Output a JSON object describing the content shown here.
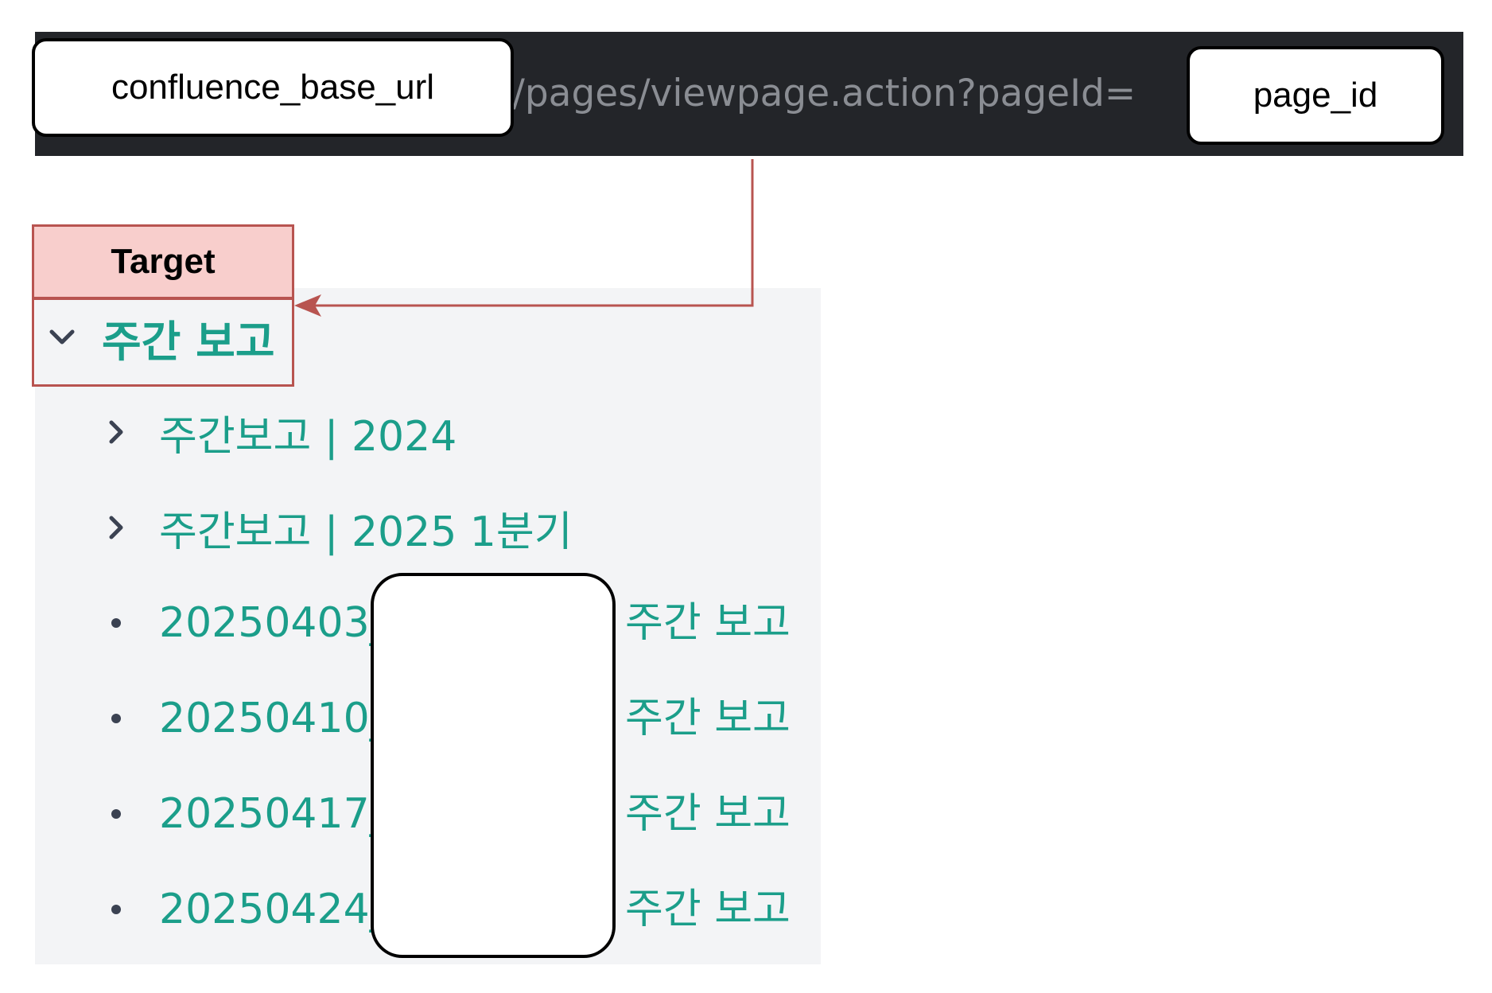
{
  "url_bar": {
    "base_url_placeholder": "confluence_base_url",
    "path": "/pages/viewpage.action?pageId=",
    "page_id_placeholder": "page_id"
  },
  "annotation": {
    "target_label": "Target",
    "color": "#b85450",
    "fill": "#f8cecc"
  },
  "tree": {
    "root": {
      "label": "주간 보고",
      "icon": "chevron-down-icon"
    },
    "children": [
      {
        "label": "주간보고 | 2024",
        "icon": "chevron-right-icon"
      },
      {
        "label": "주간보고 | 2025 1분기",
        "icon": "chevron-right-icon"
      },
      {
        "label": "20250403_",
        "suffix": "주간 보고",
        "icon": "bullet-icon"
      },
      {
        "label": "20250410_",
        "suffix": "주간 보고",
        "icon": "bullet-icon"
      },
      {
        "label": "20250417_",
        "suffix": "주간 보고",
        "icon": "bullet-icon"
      },
      {
        "label": "20250424_",
        "suffix": "주간 보고",
        "icon": "bullet-icon"
      }
    ]
  },
  "colors": {
    "link": "#1b9e8a",
    "url_bar_bg": "#232529",
    "url_text": "#8a8d93",
    "panel_bg": "#f3f4f6"
  }
}
